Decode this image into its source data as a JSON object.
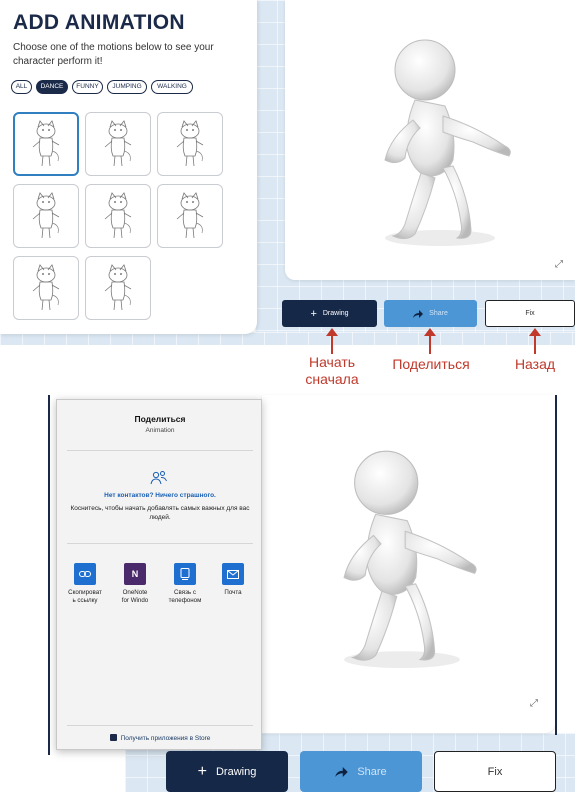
{
  "top": {
    "panel": {
      "title": "ADD ANIMATION",
      "description": "Choose one of the motions below to see your character perform it!",
      "filters": [
        {
          "label": "ALL",
          "active": false
        },
        {
          "label": "DANCE",
          "active": true
        },
        {
          "label": "FUNNY",
          "active": false
        },
        {
          "label": "JUMPING",
          "active": false
        },
        {
          "label": "WALKING",
          "active": false
        }
      ],
      "motion_count": 8,
      "selected_motion": 1
    },
    "buttons": {
      "drawing": {
        "icon": "plus-icon",
        "icon_text": "+",
        "label": "Drawing"
      },
      "share": {
        "icon": "share-arrow-icon",
        "label": "Share"
      },
      "fix": {
        "label": "Fix"
      }
    },
    "annotations": {
      "restart": "Начать\nсначала",
      "share": "Поделиться",
      "back": "Назад"
    },
    "annotation_color": "#c0392b"
  },
  "bottom": {
    "share_dialog": {
      "title": "Поделиться",
      "subtitle": "Animation",
      "no_contacts_title": "Нет контактов? Ничего страшного.",
      "no_contacts_desc": "Коснитесь, чтобы начать добавлять самых важных для вас людей.",
      "apps": [
        {
          "label": "Скопироват\nь ссылку",
          "icon": "link-icon",
          "color": "#1f6fd1"
        },
        {
          "label": "OneNote\nfor Windo",
          "icon": "onenote-icon",
          "color": "#4a2a6b"
        },
        {
          "label": "Связь с\nтелефоном",
          "icon": "phone-link-icon",
          "color": "#1f6fd1"
        },
        {
          "label": "Почта",
          "icon": "mail-icon",
          "color": "#1f6fd1"
        }
      ],
      "store_link": "Получить приложения в Store"
    },
    "buttons": {
      "drawing": {
        "icon": "plus-icon",
        "icon_text": "+",
        "label": "Drawing"
      },
      "share": {
        "icon": "share-arrow-icon",
        "label": "Share"
      },
      "fix": {
        "label": "Fix"
      }
    }
  },
  "colors": {
    "navy": "#162848",
    "share_blue": "#4c96d6",
    "selected_border": "#2f7fc1",
    "grid_bg": "#dbe8f4"
  }
}
